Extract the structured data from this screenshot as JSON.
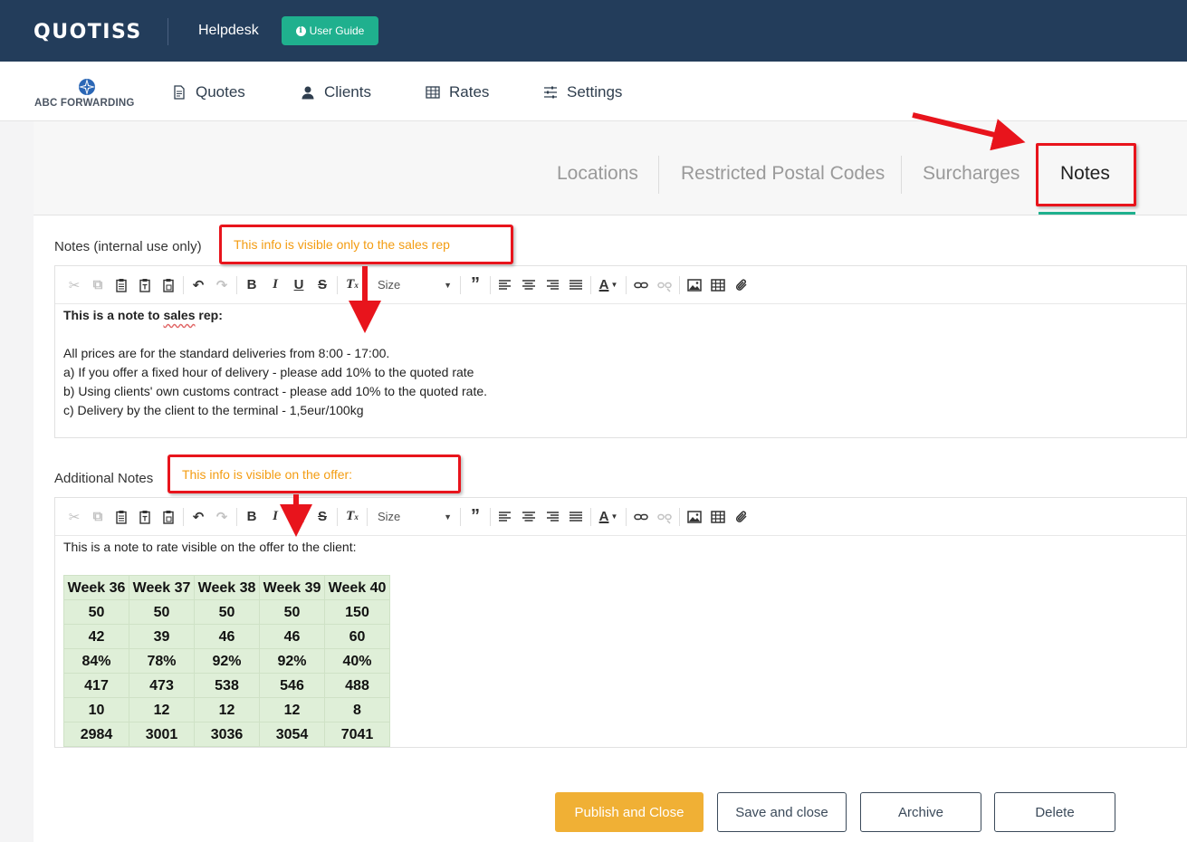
{
  "topbar": {
    "brand": "QUOTISS",
    "helpdesk": "Helpdesk",
    "user_guide": "User Guide"
  },
  "company": {
    "name": "ABC FORWARDING"
  },
  "nav": {
    "quotes": "Quotes",
    "clients": "Clients",
    "rates": "Rates",
    "settings": "Settings"
  },
  "tabs": {
    "locations": "Locations",
    "restricted": "Restricted Postal Codes",
    "surcharges": "Surcharges",
    "notes": "Notes"
  },
  "notes_section": {
    "label": "Notes (internal use only)",
    "callout": "This info is visible only to the sales rep",
    "size_placeholder": "Size",
    "line1_prefix": "This is a note to ",
    "line1_underlined": "sales",
    "line1_suffix": " rep:",
    "line2": "All prices are for the standard deliveries from 8:00 - 17:00.",
    "line3": "a) If you offer a fixed hour of delivery - please add 10% to the quoted rate",
    "line4": "b) Using clients' own customs contract - please add 10% to the quoted rate.",
    "line5": "c) Delivery by the client to the terminal - 1,5eur/100kg"
  },
  "additional_section": {
    "label": "Additional Notes",
    "callout": "This info is visible on the offer:",
    "size_placeholder": "Size",
    "intro": "This is a note to rate visible on the offer to the client:",
    "table": [
      [
        "Week 36",
        "Week 37",
        "Week 38",
        "Week 39",
        "Week 40"
      ],
      [
        "50",
        "50",
        "50",
        "50",
        "150"
      ],
      [
        "42",
        "39",
        "46",
        "46",
        "60"
      ],
      [
        "84%",
        "78%",
        "92%",
        "92%",
        "40%"
      ],
      [
        "417",
        "473",
        "538",
        "546",
        "488"
      ],
      [
        "10",
        "12",
        "12",
        "12",
        "8"
      ],
      [
        "2984",
        "3001",
        "3036",
        "3054",
        "7041"
      ]
    ]
  },
  "actions": {
    "publish": "Publish and Close",
    "save": "Save and close",
    "archive": "Archive",
    "delete": "Delete"
  },
  "colors": {
    "topbar": "#233d5b",
    "accent": "#1fb08e",
    "primary_button": "#f0b035",
    "annotation": "#e8141c",
    "callout_text": "#f39c12",
    "table_bg": "#dfefd8"
  }
}
